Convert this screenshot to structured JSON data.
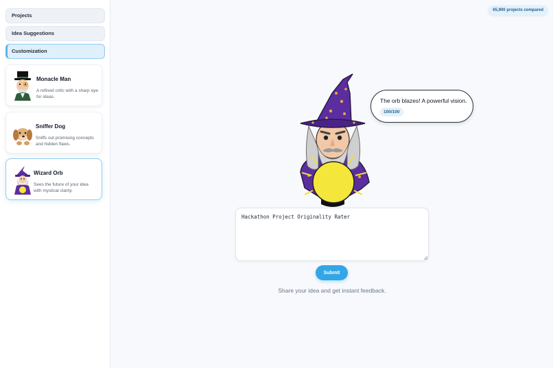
{
  "sidebar": {
    "nav": [
      {
        "label": "Projects"
      },
      {
        "label": "Idea Suggestions"
      },
      {
        "label": "Customization",
        "active": true
      }
    ],
    "personas": [
      {
        "name": "Monacle Man",
        "description": "A refined critic with a sharp eye for ideas.",
        "icon": "monocle-man-icon"
      },
      {
        "name": "Sniffer Dog",
        "description": "Sniffs out promising concepts and hidden flaws.",
        "icon": "dog-icon"
      },
      {
        "name": "Wizard Orb",
        "description": "Sees the future of your idea with mystical clarity.",
        "icon": "wizard-icon",
        "selected": true
      }
    ]
  },
  "header": {
    "projects_compared": "65,900 projects compared"
  },
  "main": {
    "speech": {
      "message": "The orb blazes! A powerful vision.",
      "score": "100/100"
    },
    "idea_input": {
      "value": "Hackathon Project Originality Rater"
    },
    "submit_label": "Submit",
    "hint": "Share your idea and get instant feedback."
  },
  "colors": {
    "accent": "#33a6e6",
    "active_border": "#8ecdf0",
    "robe": "#5b2ea0",
    "orb": "#f5e63b"
  }
}
